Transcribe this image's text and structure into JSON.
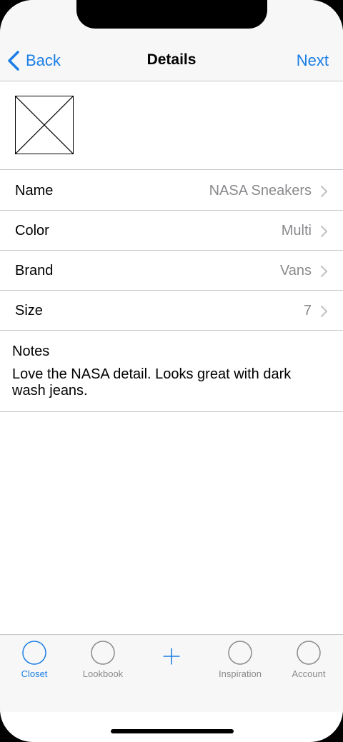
{
  "nav": {
    "back_label": "Back",
    "title": "Details",
    "next_label": "Next"
  },
  "fields": [
    {
      "label": "Name",
      "value": "NASA Sneakers"
    },
    {
      "label": "Color",
      "value": "Multi"
    },
    {
      "label": "Brand",
      "value": "Vans"
    },
    {
      "label": "Size",
      "value": "7"
    }
  ],
  "notes": {
    "label": "Notes",
    "text": "Love the NASA detail. Looks great with dark wash jeans."
  },
  "tabs": [
    {
      "label": "Closet",
      "icon": "circle-icon",
      "active": true
    },
    {
      "label": "Lookbook",
      "icon": "circle-icon",
      "active": false
    },
    {
      "label": "",
      "icon": "plus-icon",
      "active": false
    },
    {
      "label": "Inspiration",
      "icon": "circle-icon",
      "active": false
    },
    {
      "label": "Account",
      "icon": "circle-icon",
      "active": false
    }
  ],
  "colors": {
    "accent": "#1a7ee6",
    "secondary_text": "#8a8a8e",
    "separator": "#c8c8cc",
    "bar_background": "#f7f7f7"
  }
}
